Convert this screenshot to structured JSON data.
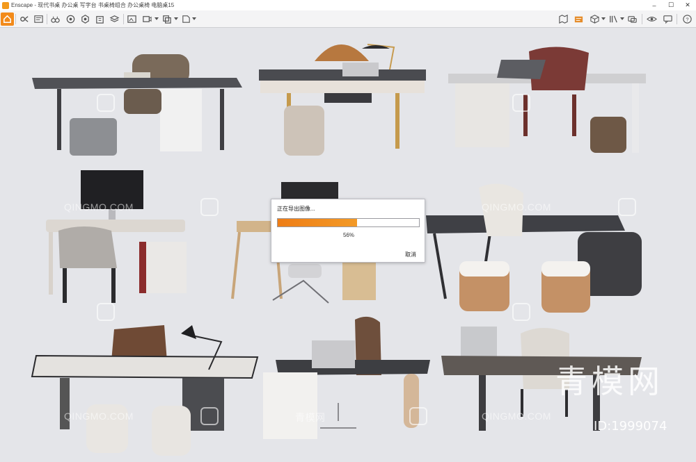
{
  "window": {
    "title": "Enscape - 现代书桌 办公桌 写字台 书桌椅组合 办公桌椅 电脑桌15",
    "controls": {
      "minimize": "–",
      "maximize": "☐",
      "close": "✕"
    }
  },
  "toolbar": {
    "left_icons": [
      "home-icon",
      "capture-icon",
      "binoculars-icon",
      "view-icon",
      "settings-icon",
      "building-icon",
      "layers-icon",
      "export-image-icon",
      "video-icon",
      "batch-icon",
      "export-icon"
    ],
    "right_icons": [
      "map-icon",
      "assets-icon",
      "cube-icon",
      "library-icon",
      "collaboration-icon",
      "visibility-icon",
      "feedback-icon",
      "help-icon"
    ],
    "help_label": "?"
  },
  "watermarks": {
    "qingmo_text": "QINGMO.COM",
    "qingmo_cn": "青模网",
    "brand_big": "青模网",
    "id_label": "ID:1999074"
  },
  "dialog": {
    "title": "正在导出图像...",
    "progress": 0.56,
    "progress_text": "56%",
    "cancel": "取消"
  },
  "colors": {
    "accent": "#f28a1a",
    "progress": "#ee7d16",
    "background": "#e4e5e9"
  }
}
